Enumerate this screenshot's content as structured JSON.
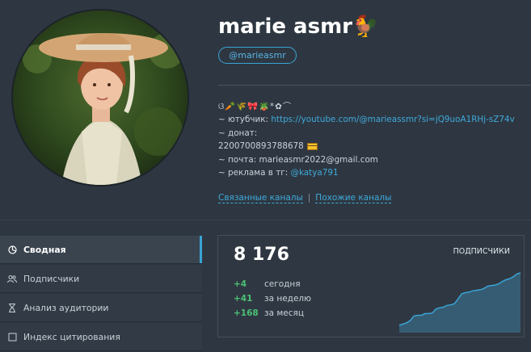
{
  "profile": {
    "name": "marie asmr",
    "name_emoji": "🐓",
    "handle": "@marieasmr"
  },
  "bio": {
    "emoji_line": "ଓ🥕🌾🎀🪴*✿⌒",
    "youtube_prefix": "~ ютубчик: ",
    "youtube_url": "https://youtube.com/@marieassmr?si=jQ9uoA1RHj-sZ74v",
    "donate_label": "~ донат:",
    "donate_number": "2200700893788678",
    "mail_line": "~ почта: marieasmr2022@gmail.com",
    "ads_prefix": "~ реклама в тг: ",
    "ads_handle": "@katya791"
  },
  "links": {
    "related": "Связанные каналы",
    "separator": "|",
    "similar": "Похожие каналы"
  },
  "menu": {
    "items": [
      {
        "label": "Сводная",
        "icon": "summary-icon"
      },
      {
        "label": "Подписчики",
        "icon": "users-icon"
      },
      {
        "label": "Анализ аудитории",
        "icon": "hourglass-icon"
      },
      {
        "label": "Индекс цитирования",
        "icon": "citation-icon"
      }
    ]
  },
  "stats": {
    "total": "8 176",
    "label": "ПОДПИСЧИКИ",
    "rows": [
      {
        "value": "+4",
        "label": "сегодня"
      },
      {
        "value": "+41",
        "label": "за неделю"
      },
      {
        "value": "+168",
        "label": "за месяц"
      }
    ],
    "sparkline": [
      0.1,
      0.12,
      0.14,
      0.18,
      0.26,
      0.27,
      0.27,
      0.3,
      0.3,
      0.31,
      0.38,
      0.4,
      0.41,
      0.44,
      0.45,
      0.47,
      0.55,
      0.64,
      0.66,
      0.67,
      0.69,
      0.7,
      0.71,
      0.73,
      0.77,
      0.78,
      0.79,
      0.81,
      0.85,
      0.88,
      0.9,
      0.93,
      0.98,
      1.0
    ]
  },
  "colors": {
    "accent": "#3aa3d6",
    "positive": "#4cc074",
    "background": "#2e3741"
  }
}
